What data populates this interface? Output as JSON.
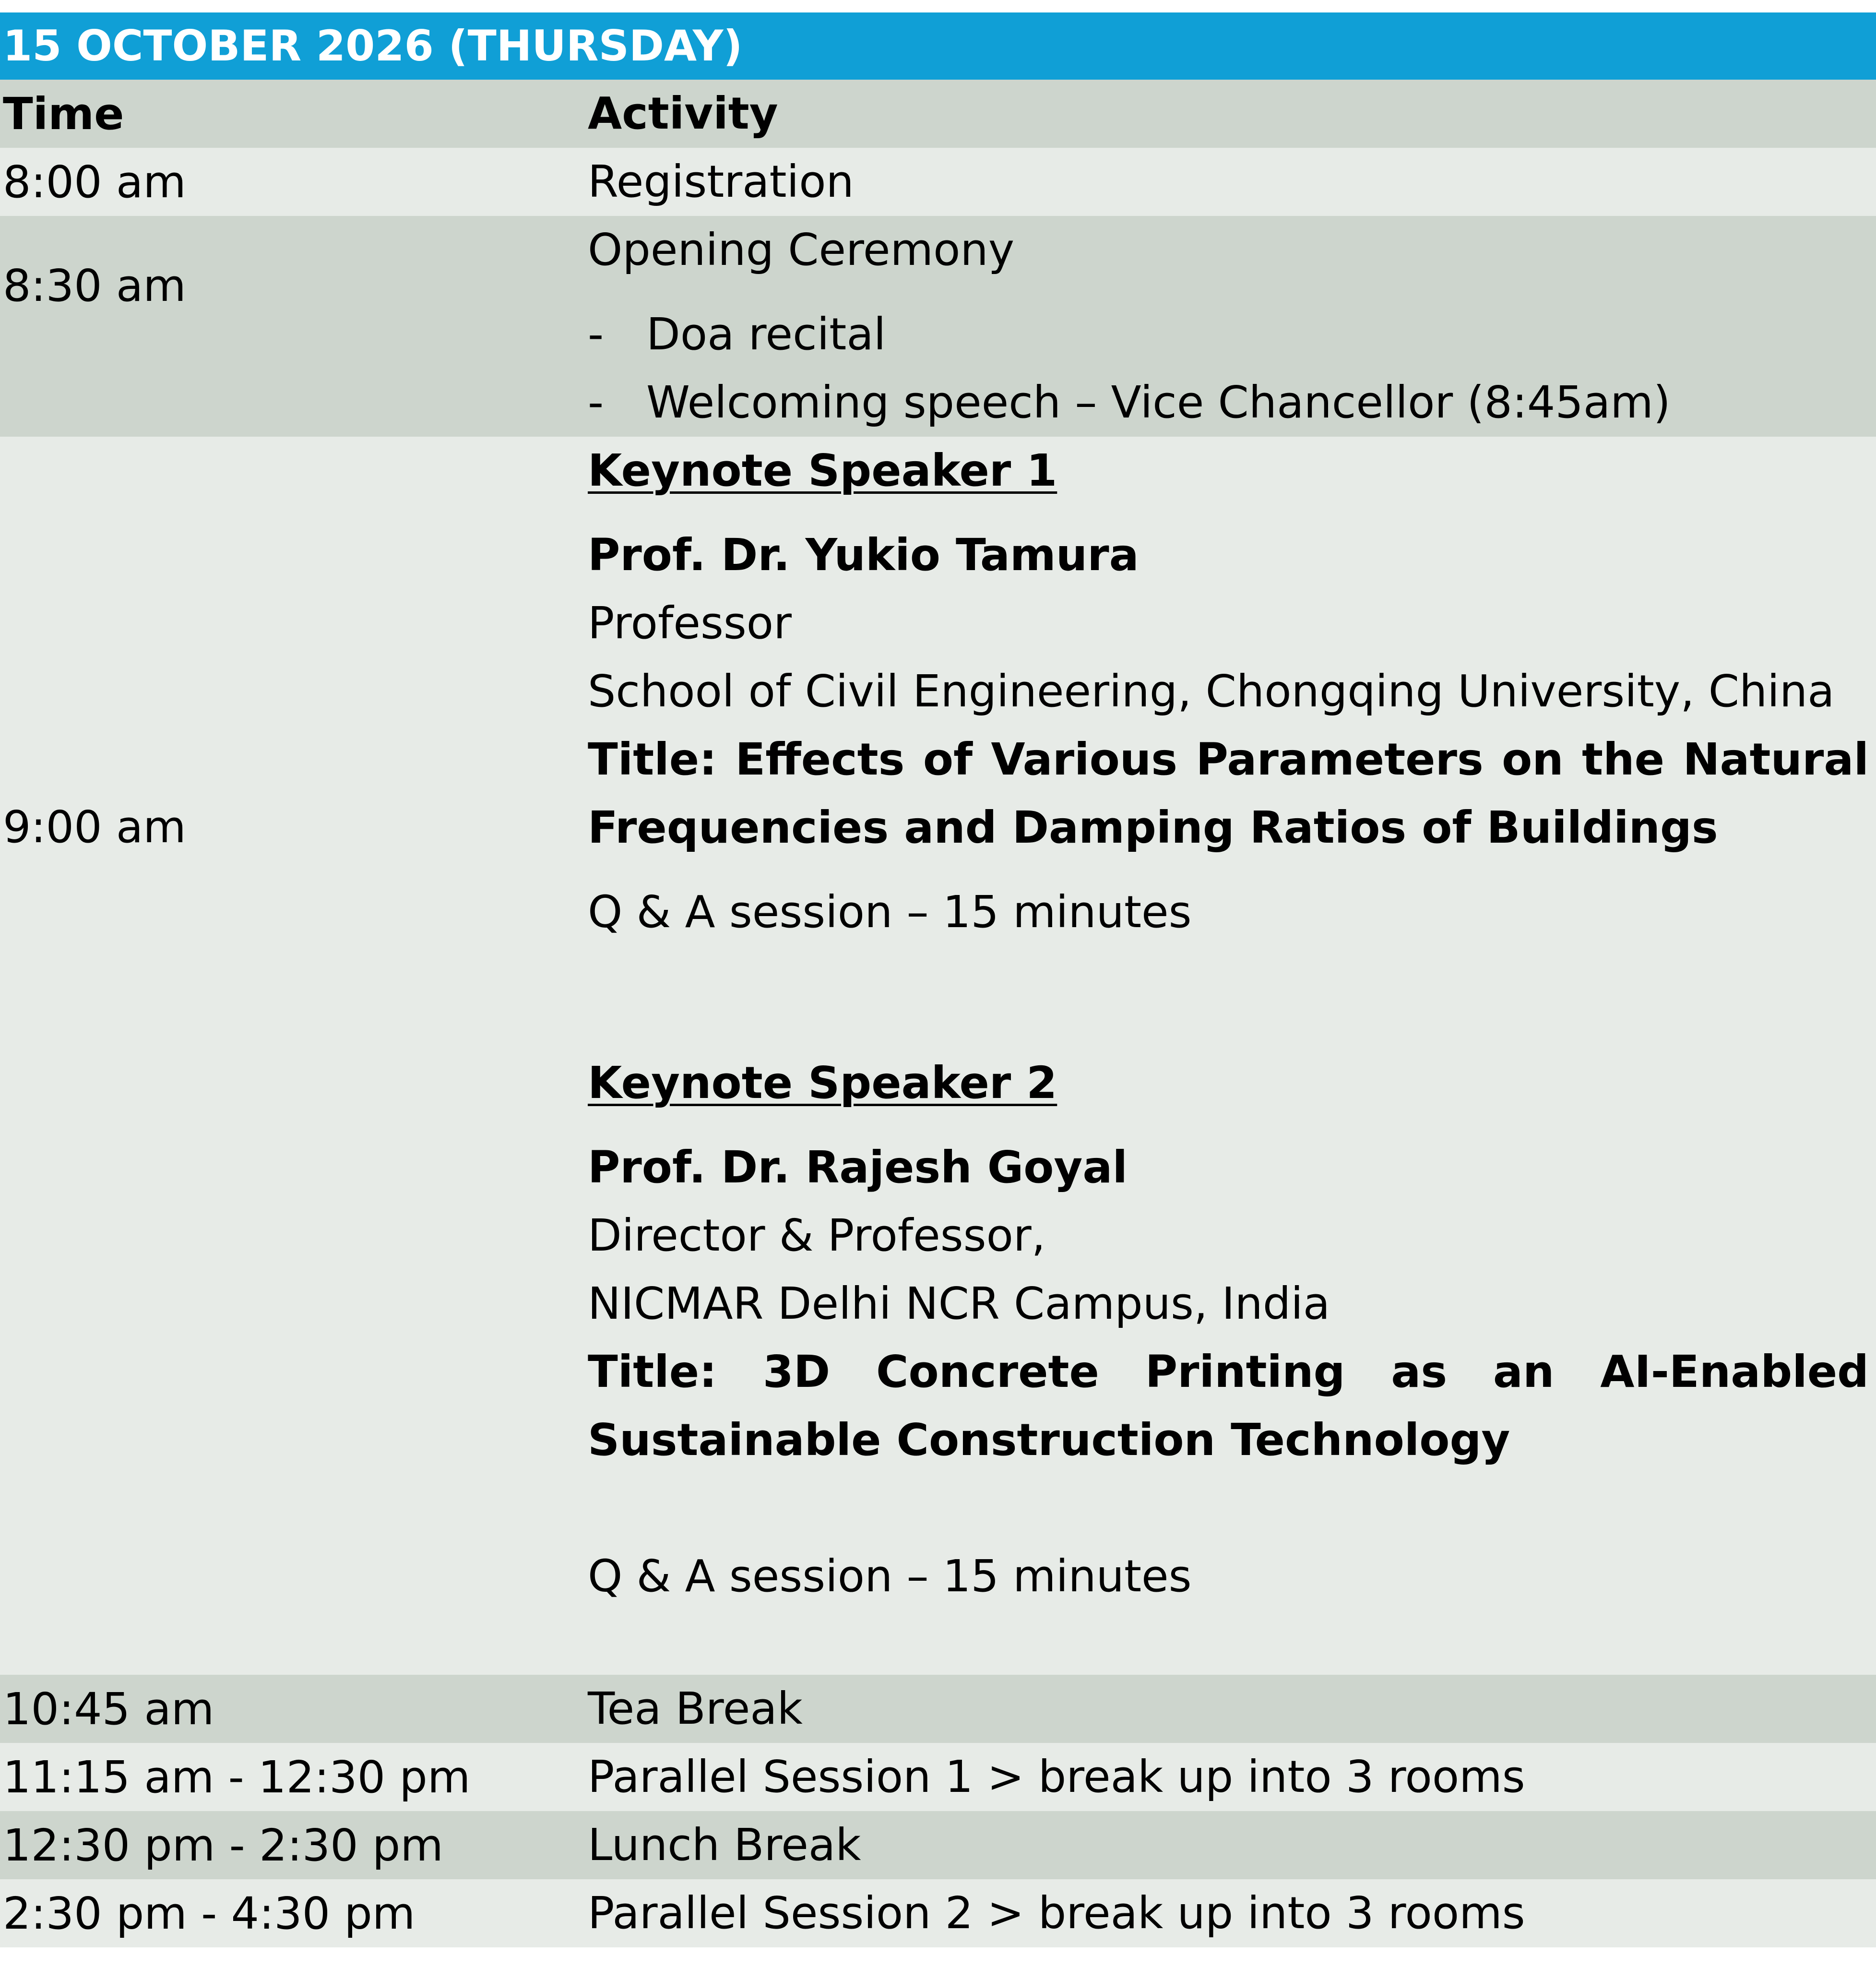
{
  "header": {
    "title": "15 OCTOBER 2026 (THURSDAY)"
  },
  "columns": {
    "time": "Time",
    "activity": "Activity"
  },
  "rows": {
    "registration": {
      "time": "8:00 am",
      "activity": "Registration"
    },
    "opening": {
      "time": "8:30 am",
      "activity": "Opening Ceremony",
      "bullets": [
        {
          "dash": "-",
          "text": "Doa recital"
        },
        {
          "dash": "-",
          "text": "Welcoming speech – Vice Chancellor (8:45am)"
        }
      ]
    },
    "keynotes": {
      "time": "9:00 am",
      "speaker1": {
        "heading": "Keynote Speaker 1",
        "name": "Prof. Dr. Yukio Tamura",
        "position": "Professor",
        "affiliation": "School of Civil Engineering, Chongqing University, China",
        "title_line1": "Title: Effects of Various Parameters on the Natural",
        "title_line2": "Frequencies and Damping Ratios of Buildings",
        "qa": "Q & A session – 15 minutes"
      },
      "speaker2": {
        "heading": "Keynote Speaker 2",
        "name": "Prof. Dr. Rajesh Goyal",
        "position": "Director & Professor,",
        "affiliation": "NICMAR Delhi NCR Campus, India",
        "title_line1": "Title: 3D Concrete Printing as an AI-Enabled",
        "title_line2": "Sustainable Construction Technology",
        "qa": "Q & A session – 15 minutes"
      }
    },
    "tea": {
      "time": "10:45 am",
      "activity": "Tea Break"
    },
    "parallel1": {
      "time": "11:15 am - 12:30 pm",
      "activity": "Parallel Session 1 > break up into 3 rooms"
    },
    "lunch": {
      "time": "12:30 pm - 2:30 pm",
      "activity": "Lunch Break"
    },
    "parallel2": {
      "time": "2:30 pm - 4:30 pm",
      "activity": "Parallel Session 2 > break up into 3 rooms"
    }
  },
  "colors": {
    "header_blue": "#109fd6",
    "row_dark": "#cdd5cd",
    "row_light": "#e7ebe7"
  }
}
